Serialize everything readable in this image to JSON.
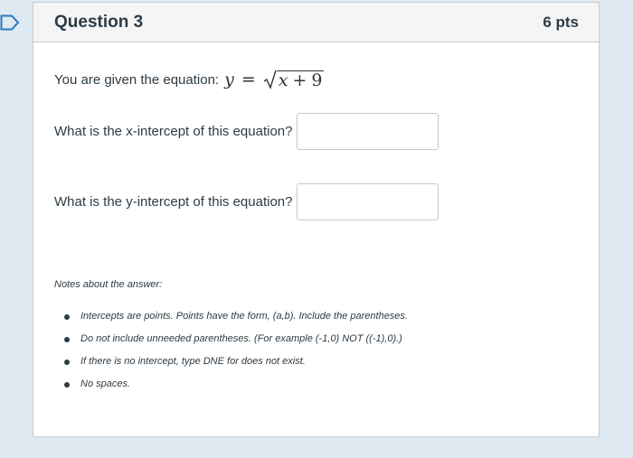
{
  "question": {
    "title": "Question 3",
    "points": "6 pts",
    "prompt": "You are given the equation:",
    "equation": {
      "lhs": "y",
      "equals": "=",
      "variable": "x",
      "operator": "+",
      "constant": "9"
    },
    "fields": [
      {
        "label": "What is the x-intercept of this equation?",
        "value": "",
        "placeholder": ""
      },
      {
        "label": "What is the y-intercept of this equation?",
        "value": "",
        "placeholder": ""
      }
    ]
  },
  "notes": {
    "title": "Notes about the answer:",
    "items": [
      "Intercepts are points. Points have the form, (a,b). Include the parentheses.",
      "Do not include unneeded parentheses. (For example (-1,0) NOT ((-1),0).)",
      "If there is no intercept, type DNE for does not exist.",
      "No spaces."
    ]
  },
  "icons": {
    "bookmark": "bookmark-icon"
  },
  "colors": {
    "accent": "#2b7abc",
    "text": "#2d3b45",
    "background": "#dfe9f1",
    "header": "#f5f5f5"
  }
}
